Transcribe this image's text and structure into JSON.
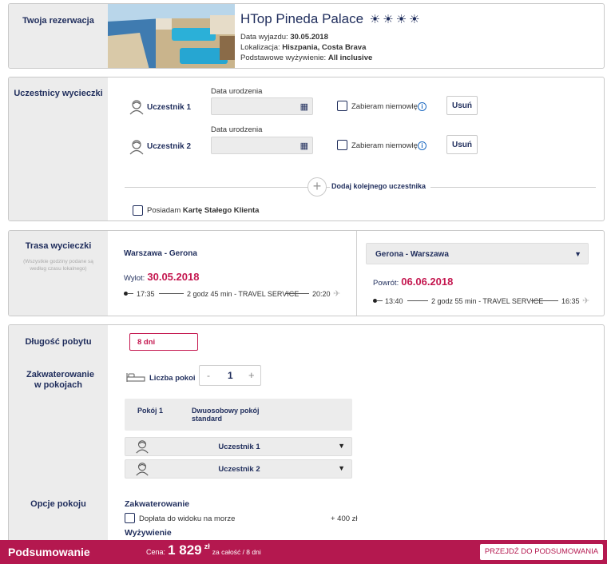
{
  "reservation": {
    "side_title": "Twoja rezerwacja",
    "hotel_name": "HTop Pineda Palace",
    "stars": [
      "☀",
      "☀",
      "☀",
      "☀"
    ],
    "departure_label": "Data wyjazdu:",
    "departure_value": "30.05.2018",
    "location_label": "Lokalizacja:",
    "location_value": "Hiszpania, Costa Brava",
    "board_label": "Podstawowe wyżywienie:",
    "board_value": "All inclusive"
  },
  "participants": {
    "side_title": "Uczestnicy wycieczki",
    "items": [
      {
        "name": "Uczestnik 1",
        "birth_label": "Data urodzenia",
        "infant_label": "Zabieram niemowlę",
        "remove_label": "Usuń"
      },
      {
        "name": "Uczestnik 2",
        "birth_label": "Data urodzenia",
        "infant_label": "Zabieram niemowlę",
        "remove_label": "Usuń"
      }
    ],
    "add_label": "Dodaj kolejnego uczestnika",
    "loyalty_prefix": "Posiadam",
    "loyalty_bold": "Kartę Stałego Klienta"
  },
  "route": {
    "side_title": "Trasa wycieczki",
    "side_note": "(Wszystkie godziny podane są według czasu lokalnego)",
    "outbound": {
      "title": "Warszawa - Gerona",
      "date_label": "Wylot:",
      "date_value": "30.05.2018",
      "dep_time": "17:35",
      "duration": "2 godz 45 min",
      "carrier": "TRAVEL SERVICE",
      "arr_time": "20:20"
    },
    "return": {
      "select_value": "Gerona - Warszawa",
      "date_label": "Powrót:",
      "date_value": "06.06.2018",
      "dep_time": "13:40",
      "duration": "2 godz 55 min",
      "carrier": "TRAVEL SERVICE",
      "arr_time": "16:35"
    }
  },
  "stay": {
    "length_label": "Długość pobytu",
    "length_value": "8 dni",
    "accommodation_label": "Zakwaterowanie w pokojach",
    "rooms_label": "Liczba pokoi",
    "rooms_minus": "-",
    "rooms_count": "1",
    "rooms_plus": "+",
    "room_name": "Pokój 1",
    "room_type": "Dwuosobowy pokój standard",
    "room_participants": [
      "Uczestnik 1",
      "Uczestnik 2"
    ],
    "options_label": "Opcje pokoju",
    "options_group_1": "Zakwaterowanie",
    "sea_view_label": "Dopłata do widoku na morze",
    "sea_view_price": "+ 400 zł",
    "options_group_2": "Wyżywienie"
  },
  "footer": {
    "title": "Podsumowanie",
    "price_label": "Cena:",
    "price_value": "1 829",
    "price_currency": "zł",
    "price_note": "za całość / 8 dni",
    "cta_label": "PRZEJDŹ DO PODSUMOWANIA"
  },
  "colors": {
    "navy": "#1f2d5c",
    "accent": "#c4174f",
    "footer_bg": "#b4184f",
    "panel_bg": "#ececec"
  }
}
